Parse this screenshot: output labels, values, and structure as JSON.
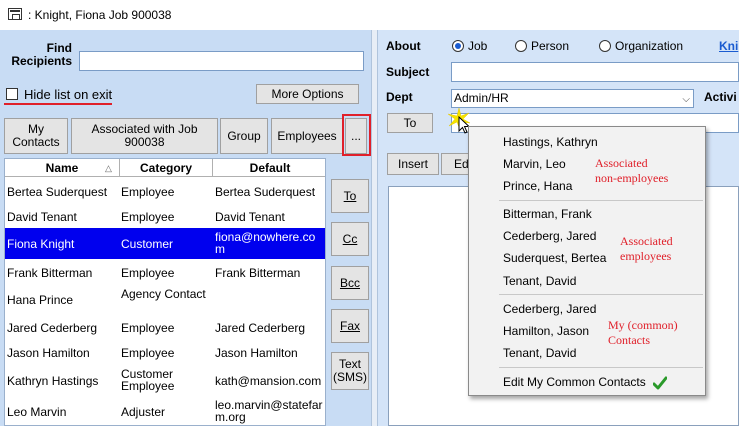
{
  "window": {
    "title": ": Knight, Fiona Job 900038"
  },
  "find": {
    "label": "Find\nRecipients",
    "value": ""
  },
  "hide_list": {
    "label": "Hide list on exit",
    "checked": false
  },
  "more_options_label": "More Options",
  "tabs": [
    {
      "label": "My\nContacts"
    },
    {
      "label": "Associated with Job\n900038"
    },
    {
      "label": "Group"
    },
    {
      "label": "Employees"
    },
    {
      "label": "..."
    }
  ],
  "grid": {
    "columns": [
      "Name",
      "Category",
      "Default"
    ],
    "sort_indicator": "△",
    "rows": [
      {
        "name": "Bertea Suderquest",
        "category": "Employee",
        "default": "Bertea Suderquest",
        "selected": false
      },
      {
        "name": "David Tenant",
        "category": "Employee",
        "default": "David Tenant",
        "selected": false
      },
      {
        "name": "Fiona Knight",
        "category": "Customer",
        "default": "fiona@nowhere.com",
        "selected": true
      },
      {
        "name": "Frank Bitterman",
        "category": "Employee",
        "default": "Frank Bitterman",
        "selected": false
      },
      {
        "name": "Hana Prince",
        "category": "Agency Contact",
        "default": "",
        "selected": false
      },
      {
        "name": "Jared Cederberg",
        "category": "Employee",
        "default": "Jared Cederberg",
        "selected": false
      },
      {
        "name": "Jason Hamilton",
        "category": "Employee",
        "default": "Jason Hamilton",
        "selected": false
      },
      {
        "name": "Kathryn Hastings",
        "category": "Customer Employee",
        "default": "kath@mansion.com",
        "selected": false
      },
      {
        "name": "Leo Marvin",
        "category": "Adjuster",
        "default": "leo.marvin@statefarm.org",
        "selected": false
      }
    ]
  },
  "side_buttons": [
    {
      "label": "To"
    },
    {
      "label": "Cc"
    },
    {
      "label": "Bcc"
    },
    {
      "label": "Fax"
    },
    {
      "label": "Text\n(SMS)"
    }
  ],
  "about": {
    "label": "About",
    "options": [
      {
        "label": "Job",
        "selected": true
      },
      {
        "label": "Person",
        "selected": false
      },
      {
        "label": "Organization",
        "selected": false
      }
    ],
    "link": "Kni"
  },
  "subject": {
    "label": "Subject",
    "value": ""
  },
  "dept": {
    "label": "Dept",
    "value": "Admin/HR"
  },
  "activity_label": "Activi",
  "to_button_label": "To",
  "insert_label": "Insert",
  "edit_label": "Ed",
  "popup": {
    "groups": [
      {
        "items": [
          "Hastings, Kathryn",
          "Marvin, Leo",
          "Prince, Hana"
        ],
        "note": "Associated\nnon-employees"
      },
      {
        "items": [
          "Bitterman, Frank",
          "Cederberg, Jared",
          "Suderquest, Bertea",
          "Tenant, David"
        ],
        "note": "Associated\nemployees"
      },
      {
        "items": [
          "Cederberg, Jared",
          "Hamilton, Jason",
          "Tenant, David"
        ],
        "note": "My (common)\nContacts"
      }
    ],
    "edit_item": "Edit My Common Contacts"
  },
  "colors": {
    "annotation_red": "#e0202a",
    "selection_blue": "#0000ee",
    "panel_blue": "#c8dcf4",
    "check_green": "#2a9a2a"
  }
}
